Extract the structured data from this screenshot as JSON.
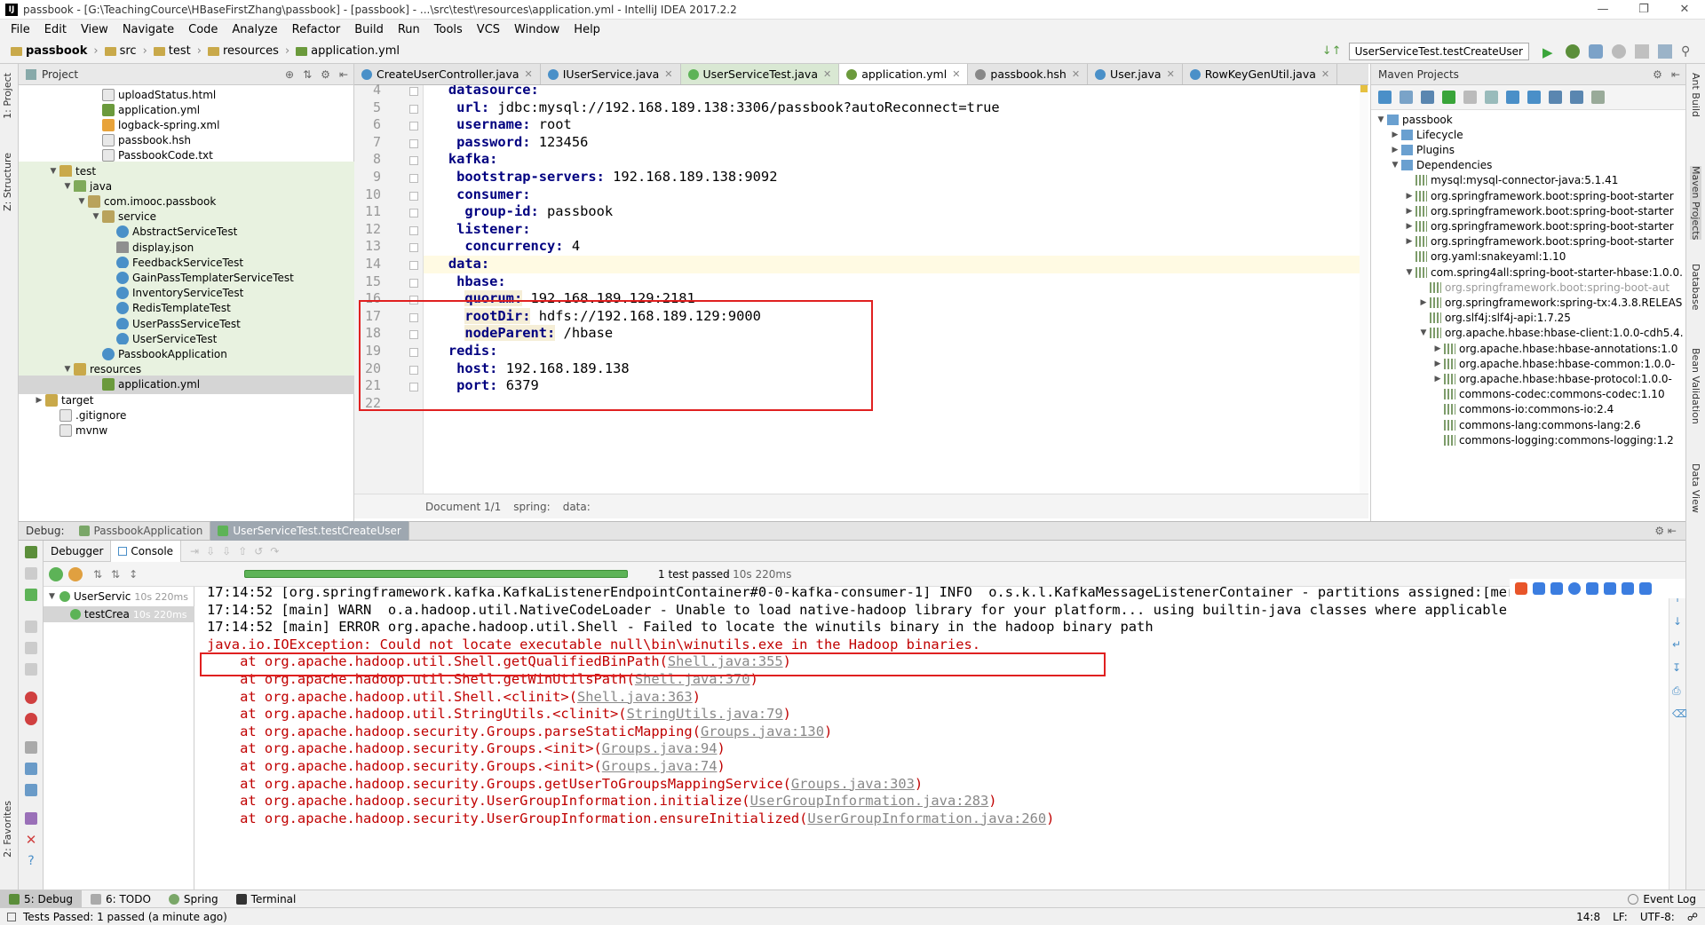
{
  "window": {
    "title": "passbook - [G:\\TeachingCource\\HBaseFirstZhang\\passbook] - [passbook] - ...\\src\\test\\resources\\application.yml - IntelliJ IDEA 2017.2.2"
  },
  "menu": [
    "File",
    "Edit",
    "View",
    "Navigate",
    "Code",
    "Analyze",
    "Refactor",
    "Build",
    "Run",
    "Tools",
    "VCS",
    "Window",
    "Help"
  ],
  "nav": {
    "crumbs": [
      "passbook",
      "src",
      "test",
      "resources",
      "application.yml"
    ],
    "run_config": "UserServiceTest.testCreateUser"
  },
  "project": {
    "header": "Project",
    "items": [
      {
        "label": "uploadStatus.html",
        "indent": 5,
        "icon": "file",
        "arrow": ""
      },
      {
        "label": "application.yml",
        "indent": 5,
        "icon": "yml",
        "arrow": ""
      },
      {
        "label": "logback-spring.xml",
        "indent": 5,
        "icon": "xml",
        "arrow": ""
      },
      {
        "label": "passbook.hsh",
        "indent": 5,
        "icon": "file",
        "arrow": ""
      },
      {
        "label": "PassbookCode.txt",
        "indent": 5,
        "icon": "file",
        "arrow": ""
      },
      {
        "label": "test",
        "indent": 2,
        "icon": "folder",
        "arrow": "v"
      },
      {
        "label": "java",
        "indent": 3,
        "icon": "folder-g",
        "arrow": "v"
      },
      {
        "label": "com.imooc.passbook",
        "indent": 4,
        "icon": "pkg",
        "arrow": "v"
      },
      {
        "label": "service",
        "indent": 5,
        "icon": "pkg",
        "arrow": "v"
      },
      {
        "label": "AbstractServiceTest",
        "indent": 6,
        "icon": "class",
        "arrow": ""
      },
      {
        "label": "display.json",
        "indent": 6,
        "icon": "json",
        "arrow": ""
      },
      {
        "label": "FeedbackServiceTest",
        "indent": 6,
        "icon": "class",
        "arrow": ""
      },
      {
        "label": "GainPassTemplaterServiceTest",
        "indent": 6,
        "icon": "class",
        "arrow": ""
      },
      {
        "label": "InventoryServiceTest",
        "indent": 6,
        "icon": "class",
        "arrow": ""
      },
      {
        "label": "RedisTemplateTest",
        "indent": 6,
        "icon": "class",
        "arrow": ""
      },
      {
        "label": "UserPassServiceTest",
        "indent": 6,
        "icon": "class",
        "arrow": ""
      },
      {
        "label": "UserServiceTest",
        "indent": 6,
        "icon": "class",
        "arrow": ""
      },
      {
        "label": "PassbookApplication",
        "indent": 5,
        "icon": "class",
        "arrow": ""
      },
      {
        "label": "resources",
        "indent": 3,
        "icon": "folder",
        "arrow": "v"
      },
      {
        "label": "application.yml",
        "indent": 5,
        "icon": "yml",
        "arrow": ""
      },
      {
        "label": "target",
        "indent": 1,
        "icon": "folder",
        "arrow": ">"
      },
      {
        "label": ".gitignore",
        "indent": 2,
        "icon": "file",
        "arrow": ""
      },
      {
        "label": "mvnw",
        "indent": 2,
        "icon": "file",
        "arrow": ""
      }
    ]
  },
  "editor_tabs": [
    {
      "label": "CreateUserController.java"
    },
    {
      "label": "IUserService.java"
    },
    {
      "label": "UserServiceTest.java"
    },
    {
      "label": "application.yml"
    },
    {
      "label": "passbook.hsh"
    },
    {
      "label": "User.java"
    },
    {
      "label": "RowKeyGenUtil.java"
    }
  ],
  "code_lines": [
    {
      "n": "4",
      "key": "datasource:",
      "val": "",
      "indent": 4
    },
    {
      "n": "5",
      "key": "url:",
      "val": " jdbc:mysql://192.168.189.138:3306/passbook?autoReconnect=true",
      "indent": 6
    },
    {
      "n": "6",
      "key": "username:",
      "val": " root",
      "indent": 6
    },
    {
      "n": "7",
      "key": "password:",
      "val": " 123456",
      "indent": 6
    },
    {
      "n": "8",
      "key": "kafka:",
      "val": "",
      "indent": 4
    },
    {
      "n": "9",
      "key": "bootstrap-servers:",
      "val": " 192.168.189.138:9092",
      "indent": 6
    },
    {
      "n": "10",
      "key": "consumer:",
      "val": "",
      "indent": 6
    },
    {
      "n": "11",
      "key": "group-id:",
      "val": " passbook",
      "indent": 8
    },
    {
      "n": "12",
      "key": "listener:",
      "val": "",
      "indent": 6
    },
    {
      "n": "13",
      "key": "concurrency:",
      "val": " 4",
      "indent": 8
    },
    {
      "n": "14",
      "key": "data:",
      "val": "",
      "indent": 4
    },
    {
      "n": "15",
      "key": "hbase:",
      "val": "",
      "indent": 6
    },
    {
      "n": "16",
      "key": "quorum:",
      "val": " 192.168.189.129:2181",
      "indent": 8
    },
    {
      "n": "17",
      "key": "rootDir:",
      "val": " hdfs://192.168.189.129:9000",
      "indent": 8
    },
    {
      "n": "18",
      "key": "nodeParent:",
      "val": " /hbase",
      "indent": 8
    },
    {
      "n": "19",
      "key": "redis:",
      "val": "",
      "indent": 4
    },
    {
      "n": "20",
      "key": "host:",
      "val": " 192.168.189.138",
      "indent": 6
    },
    {
      "n": "21",
      "key": "port:",
      "val": " 6379",
      "indent": 6
    },
    {
      "n": "22",
      "key": "",
      "val": "",
      "indent": 0
    }
  ],
  "editor_breadcrumb": [
    "Document 1/1",
    "spring:",
    "data:"
  ],
  "maven": {
    "header": "Maven Projects",
    "items": [
      {
        "label": "passbook",
        "indent": 0,
        "arrow": "v",
        "icon": "lc",
        "gray": false
      },
      {
        "label": "Lifecycle",
        "indent": 1,
        "arrow": ">",
        "icon": "lc",
        "gray": false
      },
      {
        "label": "Plugins",
        "indent": 1,
        "arrow": ">",
        "icon": "lc",
        "gray": false
      },
      {
        "label": "Dependencies",
        "indent": 1,
        "arrow": "v",
        "icon": "lc",
        "gray": false
      },
      {
        "label": "mysql:mysql-connector-java:5.1.41",
        "indent": 2,
        "arrow": "",
        "icon": "dep",
        "gray": false
      },
      {
        "label": "org.springframework.boot:spring-boot-starter",
        "indent": 2,
        "arrow": ">",
        "icon": "dep",
        "gray": false
      },
      {
        "label": "org.springframework.boot:spring-boot-starter",
        "indent": 2,
        "arrow": ">",
        "icon": "dep",
        "gray": false
      },
      {
        "label": "org.springframework.boot:spring-boot-starter",
        "indent": 2,
        "arrow": ">",
        "icon": "dep",
        "gray": false
      },
      {
        "label": "org.springframework.boot:spring-boot-starter",
        "indent": 2,
        "arrow": ">",
        "icon": "dep",
        "gray": false
      },
      {
        "label": "org.yaml:snakeyaml:1.10",
        "indent": 2,
        "arrow": "",
        "icon": "dep",
        "gray": false
      },
      {
        "label": "com.spring4all:spring-boot-starter-hbase:1.0.0.",
        "indent": 2,
        "arrow": "v",
        "icon": "dep",
        "gray": false
      },
      {
        "label": "org.springframework.boot:spring-boot-aut",
        "indent": 3,
        "arrow": "",
        "icon": "dep",
        "gray": true
      },
      {
        "label": "org.springframework:spring-tx:4.3.8.RELEAS",
        "indent": 3,
        "arrow": ">",
        "icon": "dep",
        "gray": false
      },
      {
        "label": "org.slf4j:slf4j-api:1.7.25",
        "indent": 3,
        "arrow": "",
        "icon": "dep",
        "gray": false
      },
      {
        "label": "org.apache.hbase:hbase-client:1.0.0-cdh5.4.",
        "indent": 3,
        "arrow": "v",
        "icon": "dep",
        "gray": false
      },
      {
        "label": "org.apache.hbase:hbase-annotations:1.0",
        "indent": 4,
        "arrow": ">",
        "icon": "dep",
        "gray": false
      },
      {
        "label": "org.apache.hbase:hbase-common:1.0.0-",
        "indent": 4,
        "arrow": ">",
        "icon": "dep",
        "gray": false
      },
      {
        "label": "org.apache.hbase:hbase-protocol:1.0.0-",
        "indent": 4,
        "arrow": ">",
        "icon": "dep",
        "gray": false
      },
      {
        "label": "commons-codec:commons-codec:1.10",
        "indent": 4,
        "arrow": "",
        "icon": "dep",
        "gray": false
      },
      {
        "label": "commons-io:commons-io:2.4",
        "indent": 4,
        "arrow": "",
        "icon": "dep",
        "gray": false
      },
      {
        "label": "commons-lang:commons-lang:2.6",
        "indent": 4,
        "arrow": "",
        "icon": "dep",
        "gray": false
      },
      {
        "label": "commons-logging:commons-logging:1.2",
        "indent": 4,
        "arrow": "",
        "icon": "dep",
        "gray": false
      }
    ]
  },
  "right_strip": [
    "Ant Build",
    "Maven Projects",
    "Database",
    "Bean Validation",
    "Data View"
  ],
  "left_strip": [
    "1: Project",
    "Z: Structure",
    "2: Favorites"
  ],
  "debug": {
    "label": "Debug:",
    "tabs": [
      "PassbookApplication",
      "UserServiceTest.testCreateUser"
    ],
    "subtabs": [
      "Debugger",
      "Console"
    ],
    "test_status": "1 test passed",
    "test_time": " - 10s 220ms",
    "tree": [
      {
        "label": "UserServic",
        "time": "10s 220ms"
      },
      {
        "label": "testCrea",
        "time": "10s 220ms"
      }
    ]
  },
  "console_lines": [
    {
      "text": "17:14:52 [org.springframework.kafka.KafkaListenerEndpointContainer#0-0-kafka-consumer-1] INFO  o.s.k.l.KafkaMessageListenerContainer - partitions assigned:[merchant",
      "pre": "",
      "link": "",
      "post": "",
      "err": false
    },
    {
      "text": "17:14:52 [main] WARN  o.a.hadoop.util.NativeCodeLoader - Unable to load native-hadoop library for your platform... using builtin-java classes where applicable",
      "pre": "",
      "link": "",
      "post": "",
      "err": false
    },
    {
      "text": "17:14:52 [main] ERROR org.apache.hadoop.util.Shell - Failed to locate the winutils binary in the hadoop binary path",
      "pre": "",
      "link": "",
      "post": "",
      "err": false
    },
    {
      "text": "java.io.IOException: Could not locate executable null\\bin\\winutils.exe in the Hadoop binaries.",
      "pre": "",
      "link": "",
      "post": "",
      "err": true
    },
    {
      "text": "",
      "pre": "    at org.apache.hadoop.util.Shell.getQualifiedBinPath(",
      "link": "Shell.java:355",
      "post": ")",
      "err": true
    },
    {
      "text": "",
      "pre": "    at org.apache.hadoop.util.Shell.getWinUtilsPath(",
      "link": "Shell.java:370",
      "post": ")",
      "err": true
    },
    {
      "text": "",
      "pre": "    at org.apache.hadoop.util.Shell.<clinit>(",
      "link": "Shell.java:363",
      "post": ")",
      "err": true
    },
    {
      "text": "",
      "pre": "    at org.apache.hadoop.util.StringUtils.<clinit>(",
      "link": "StringUtils.java:79",
      "post": ")",
      "err": true
    },
    {
      "text": "",
      "pre": "    at org.apache.hadoop.security.Groups.parseStaticMapping(",
      "link": "Groups.java:130",
      "post": ")",
      "err": true
    },
    {
      "text": "",
      "pre": "    at org.apache.hadoop.security.Groups.<init>(",
      "link": "Groups.java:94",
      "post": ")",
      "err": true
    },
    {
      "text": "",
      "pre": "    at org.apache.hadoop.security.Groups.<init>(",
      "link": "Groups.java:74",
      "post": ")",
      "err": true
    },
    {
      "text": "",
      "pre": "    at org.apache.hadoop.security.Groups.getUserToGroupsMappingService(",
      "link": "Groups.java:303",
      "post": ")",
      "err": true
    },
    {
      "text": "",
      "pre": "    at org.apache.hadoop.security.UserGroupInformation.initialize(",
      "link": "UserGroupInformation.java:283",
      "post": ")",
      "err": true
    },
    {
      "text": "",
      "pre": "    at org.apache.hadoop.security.UserGroupInformation.ensureInitialized(",
      "link": "UserGroupInformation.java:260",
      "post": ")",
      "err": true
    }
  ],
  "bottom_tabs": [
    "5: Debug",
    "6: TODO",
    "Spring",
    "Terminal"
  ],
  "event_log": "Event Log",
  "status": {
    "message": "Tests Passed: 1 passed (a minute ago)",
    "pos": "14:8",
    "lf": "LF:",
    "enc": "UTF-8:"
  },
  "colors": {
    "keyword": "#000080",
    "error": "#c00000",
    "highlight_box": "#e02020",
    "pass_green": "#5db357"
  }
}
